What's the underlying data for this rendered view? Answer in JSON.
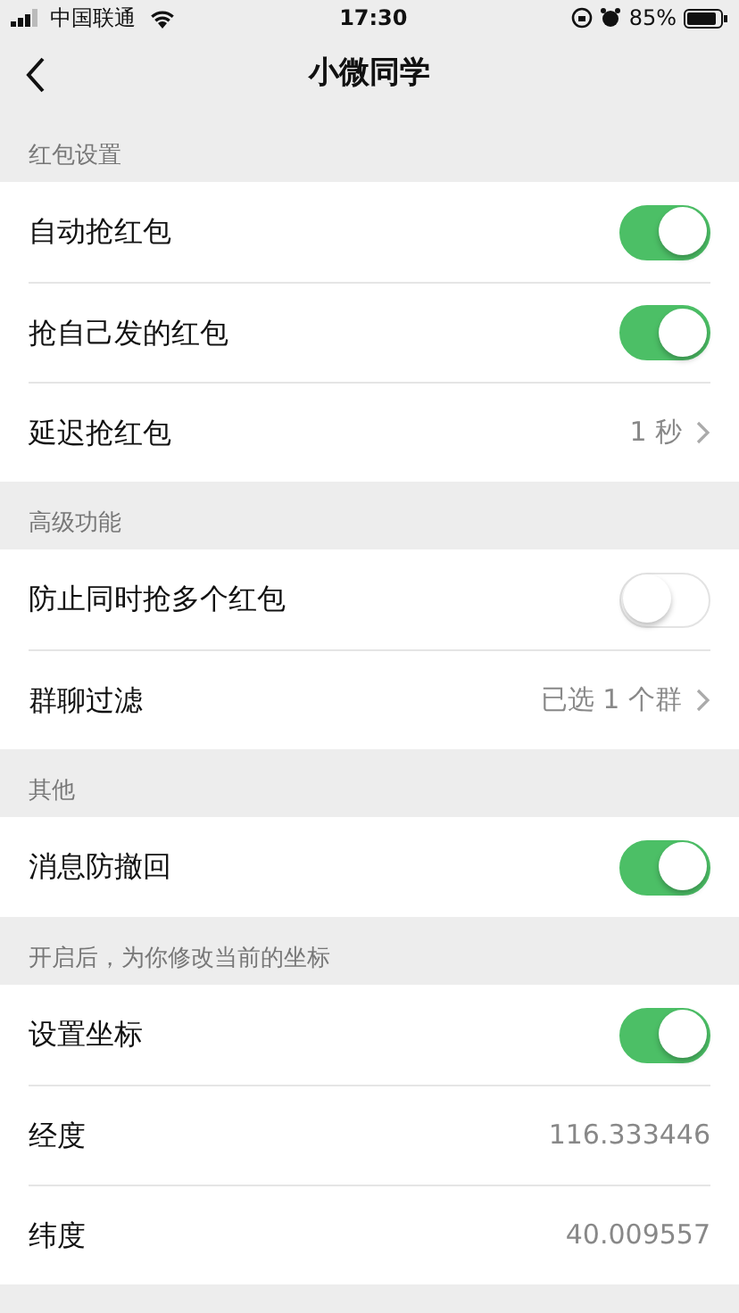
{
  "status_bar": {
    "carrier": "中国联通",
    "time": "17:30",
    "battery": "85%"
  },
  "nav": {
    "title": "小微同学"
  },
  "sections": [
    {
      "header": "红包设置",
      "rows": [
        {
          "kind": "toggle",
          "label": "自动抢红包",
          "on": true
        },
        {
          "kind": "toggle",
          "label": "抢自己发的红包",
          "on": true
        },
        {
          "kind": "link",
          "label": "延迟抢红包",
          "value": "1 秒"
        }
      ]
    },
    {
      "header": "高级功能",
      "rows": [
        {
          "kind": "toggle",
          "label": "防止同时抢多个红包",
          "on": false
        },
        {
          "kind": "link",
          "label": "群聊过滤",
          "value": "已选 1 个群"
        }
      ]
    },
    {
      "header": "其他",
      "rows": [
        {
          "kind": "toggle",
          "label": "消息防撤回",
          "on": true
        }
      ]
    },
    {
      "header": "开启后，为你修改当前的坐标",
      "rows": [
        {
          "kind": "toggle",
          "label": "设置坐标",
          "on": true
        },
        {
          "kind": "value",
          "label": "经度",
          "value": "116.333446"
        },
        {
          "kind": "value",
          "label": "纬度",
          "value": "40.009557"
        }
      ]
    }
  ]
}
